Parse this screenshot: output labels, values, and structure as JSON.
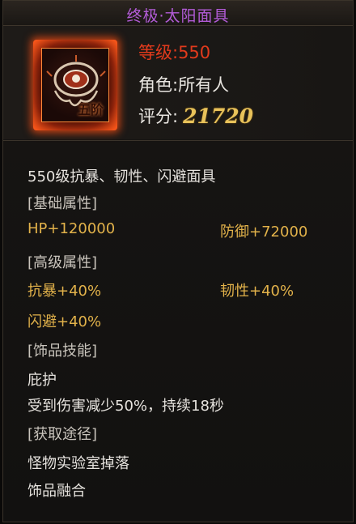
{
  "item": {
    "title": "终极·太阳面具",
    "icon": "sun-mask-icon",
    "tier_label": "五阶",
    "level": "等级:550",
    "role": "角色:所有人",
    "score_label": "评分:",
    "score_value": "21720"
  },
  "description": "550级抗暴、韧性、闪避面具",
  "sections": {
    "basic": {
      "header": "[基础属性]",
      "hp": "HP+120000",
      "defense": "防御+72000"
    },
    "advanced": {
      "header": "[高级属性]",
      "anti_crit": "抗暴+40%",
      "toughness": "韧性+40%",
      "dodge": "闪避+40%"
    },
    "skill": {
      "header": "[饰品技能]",
      "name": "庇护",
      "effect": "受到伤害减少50%，持续18秒"
    },
    "source": {
      "header": "[获取途径]",
      "item1": "怪物实验室掉落",
      "item2": "饰品融合"
    }
  },
  "colors": {
    "title": "#b35cd8",
    "level": "#e23a1c",
    "score": "#e8c25a",
    "attribute": "#e2b24a",
    "text": "#e6e3de"
  }
}
